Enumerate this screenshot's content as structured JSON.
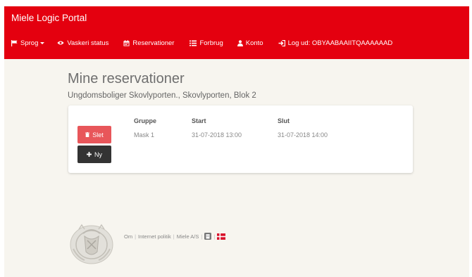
{
  "navbar": {
    "brand": "Miele Logic Portal",
    "items": [
      {
        "label": "Sprog",
        "icon": "flag-icon"
      },
      {
        "label": "Vaskeri status",
        "icon": "eye-icon"
      },
      {
        "label": "Reservationer",
        "icon": "calendar-icon"
      },
      {
        "label": "Forbrug",
        "icon": "list-icon"
      },
      {
        "label": "Konto",
        "icon": "user-icon"
      },
      {
        "label": "Log ud: OBYAABAAIITQAAAAAAD",
        "icon": "logout-icon"
      }
    ]
  },
  "main": {
    "title": "Mine reservationer",
    "subtitle": "Ungdomsboliger Skovlyporten., Skovlyporten, Blok 2"
  },
  "table": {
    "headers": [
      "Gruppe",
      "Start",
      "Slut"
    ],
    "rows": [
      {
        "group": "Mask 1",
        "start": "31-07-2018 13:00",
        "end": "31-07-2018 14:00"
      }
    ]
  },
  "buttons": {
    "delete_label": "Slet",
    "new_label": "Ny"
  },
  "footer": {
    "links": [
      "Om",
      "Internet politik",
      "Miele A/S"
    ]
  },
  "colors": {
    "brand_red": "#e4000f",
    "delete_button": "#e8565a",
    "new_button": "#333333",
    "background": "#f7f5ef"
  }
}
